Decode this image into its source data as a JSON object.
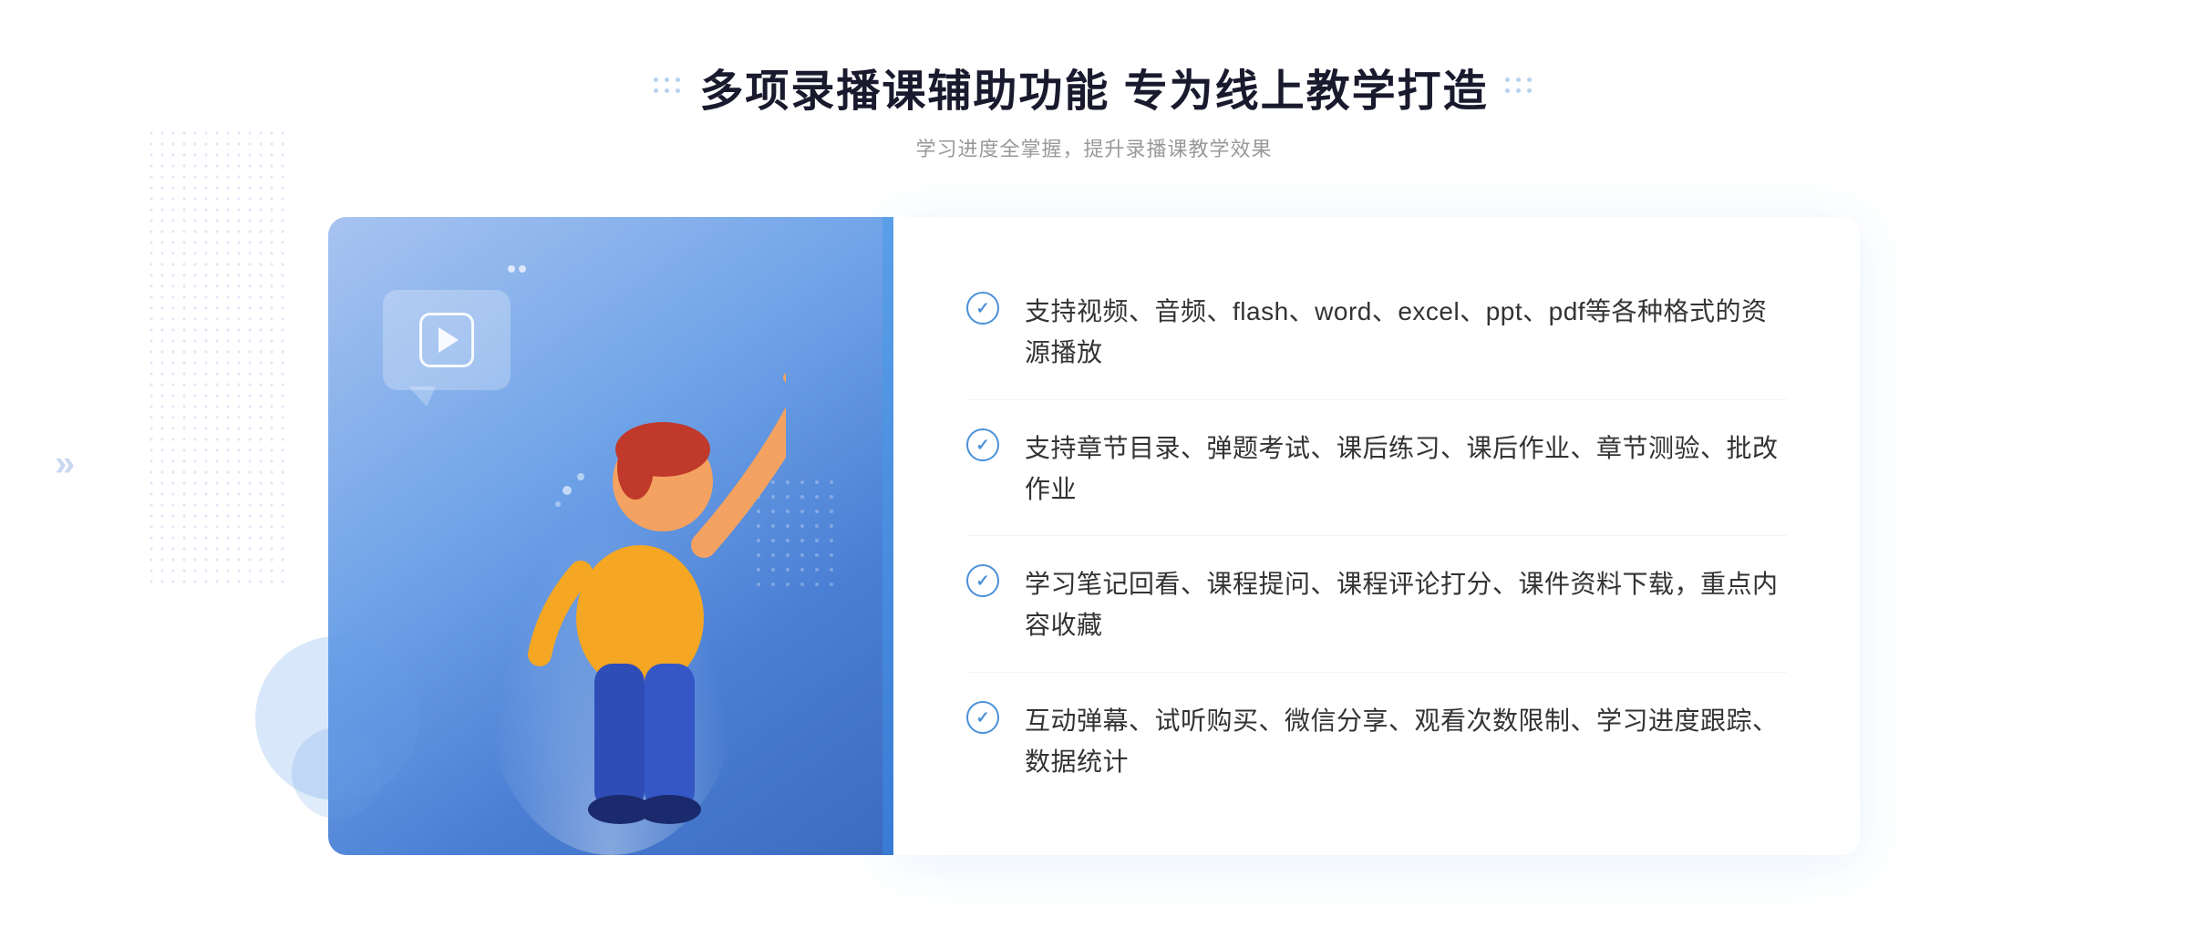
{
  "header": {
    "title": "多项录播课辅助功能 专为线上教学打造",
    "subtitle": "学习进度全掌握，提升录播课教学效果"
  },
  "features": [
    {
      "id": "feature-1",
      "text": "支持视频、音频、flash、word、excel、ppt、pdf等各种格式的资源播放"
    },
    {
      "id": "feature-2",
      "text": "支持章节目录、弹题考试、课后练习、课后作业、章节测验、批改作业"
    },
    {
      "id": "feature-3",
      "text": "学习笔记回看、课程提问、课程评论打分、课件资料下载，重点内容收藏"
    },
    {
      "id": "feature-4",
      "text": "互动弹幕、试听购买、微信分享、观看次数限制、学习进度跟踪、数据统计"
    }
  ],
  "decorations": {
    "chevron": "»",
    "play_aria": "播放按钮"
  }
}
